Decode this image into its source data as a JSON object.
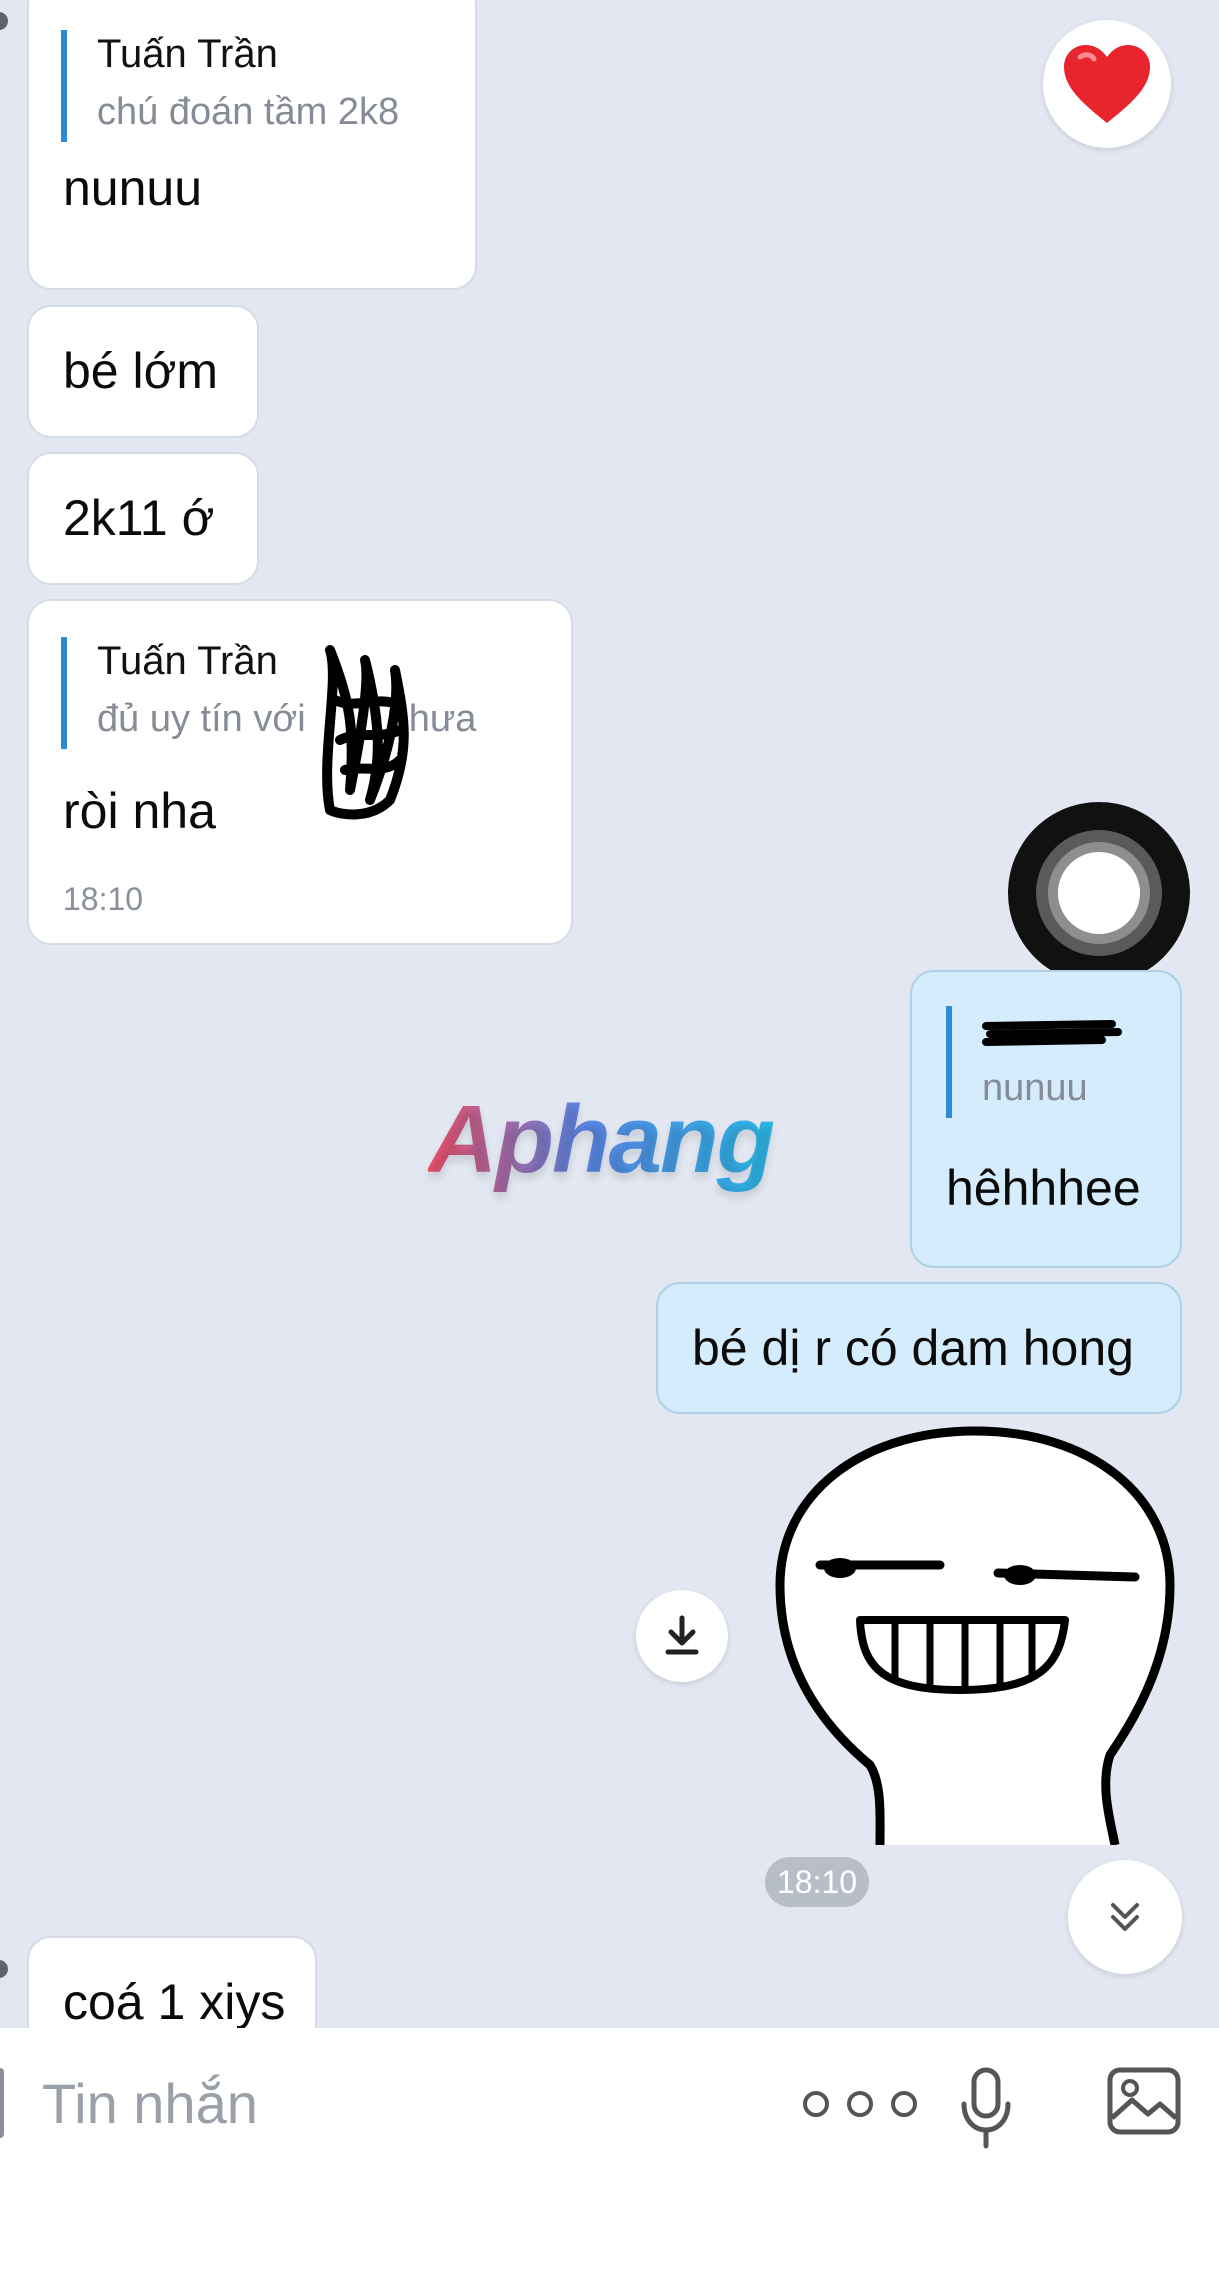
{
  "messages": {
    "m1": {
      "quote_name": "Tuấn Trần",
      "quote_text": "chú đoán tầm 2k8",
      "text": "nunuu"
    },
    "m2": {
      "text": "bé lớm"
    },
    "m3": {
      "text": "2k11 ớ"
    },
    "m4": {
      "quote_name": "Tuấn Trần",
      "quote_text": "đủ uy tín với",
      "quote_text_2": "chưa",
      "text": "ròi nha",
      "time": "18:10"
    },
    "m5": {
      "quote_text": "nunuu",
      "text": "hêhhhee"
    },
    "m6": {
      "text": "bé dị r có dam hong"
    },
    "m7": {
      "text": "coá 1 xiys"
    }
  },
  "sticker_time": "18:10",
  "watermark": "Aphang",
  "input": {
    "placeholder": "Tin nhắn"
  },
  "icons": {
    "reaction": "heart-icon",
    "download": "download-icon",
    "scroll": "chevrons-down-icon",
    "more": "more-icon",
    "mic": "microphone-icon",
    "image": "image-icon",
    "assistive": "assistive-touch-icon"
  },
  "colors": {
    "background": "#e2e7f1",
    "outgoing": "#d4ecfb",
    "quote_bar": "#2a8bd6"
  }
}
